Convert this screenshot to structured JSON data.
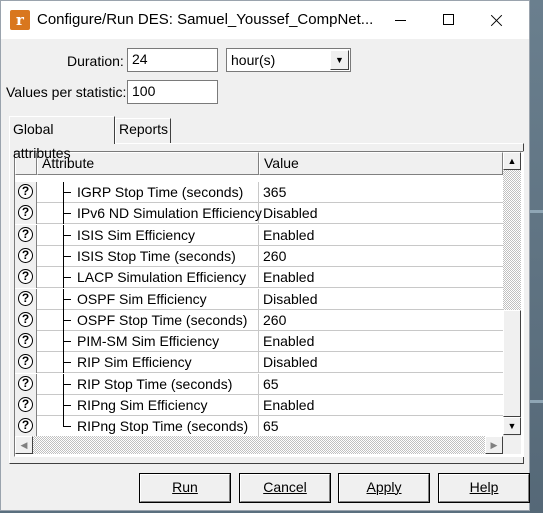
{
  "window": {
    "title": "Configure/Run DES: Samuel_Youssef_CompNet...",
    "app_icon_letter": "r",
    "app_icon_color": "#d9771e"
  },
  "duration": {
    "label": "Duration:",
    "value": "24",
    "unit": "hour(s)"
  },
  "values_per_statistic": {
    "label": "Values per statistic:",
    "value": "100"
  },
  "tabs": [
    {
      "label": "Global attributes",
      "selected": true
    },
    {
      "label": "Reports",
      "selected": false
    }
  ],
  "grid": {
    "columns": [
      "Attribute",
      "Value"
    ],
    "rows": [
      {
        "attribute": "IGRP Stop Time (seconds)",
        "value": "365"
      },
      {
        "attribute": "IPv6 ND Simulation Efficiency",
        "value": "Disabled"
      },
      {
        "attribute": "ISIS Sim Efficiency",
        "value": "Enabled"
      },
      {
        "attribute": "ISIS Stop Time (seconds)",
        "value": "260"
      },
      {
        "attribute": "LACP Simulation Efficiency",
        "value": "Enabled"
      },
      {
        "attribute": "OSPF Sim Efficiency",
        "value": "Disabled"
      },
      {
        "attribute": "OSPF Stop Time (seconds)",
        "value": "260"
      },
      {
        "attribute": "PIM-SM Sim Efficiency",
        "value": "Enabled"
      },
      {
        "attribute": "RIP Sim Efficiency",
        "value": "Disabled"
      },
      {
        "attribute": "RIP Stop Time (seconds)",
        "value": "65"
      },
      {
        "attribute": "RIPng Sim Efficiency",
        "value": "Enabled"
      },
      {
        "attribute": "RIPng Stop Time (seconds)",
        "value": "65"
      }
    ],
    "help_icon_glyph": "?"
  },
  "buttons": {
    "run": "Run",
    "cancel": "Cancel",
    "apply": "Apply",
    "help": "Help"
  }
}
